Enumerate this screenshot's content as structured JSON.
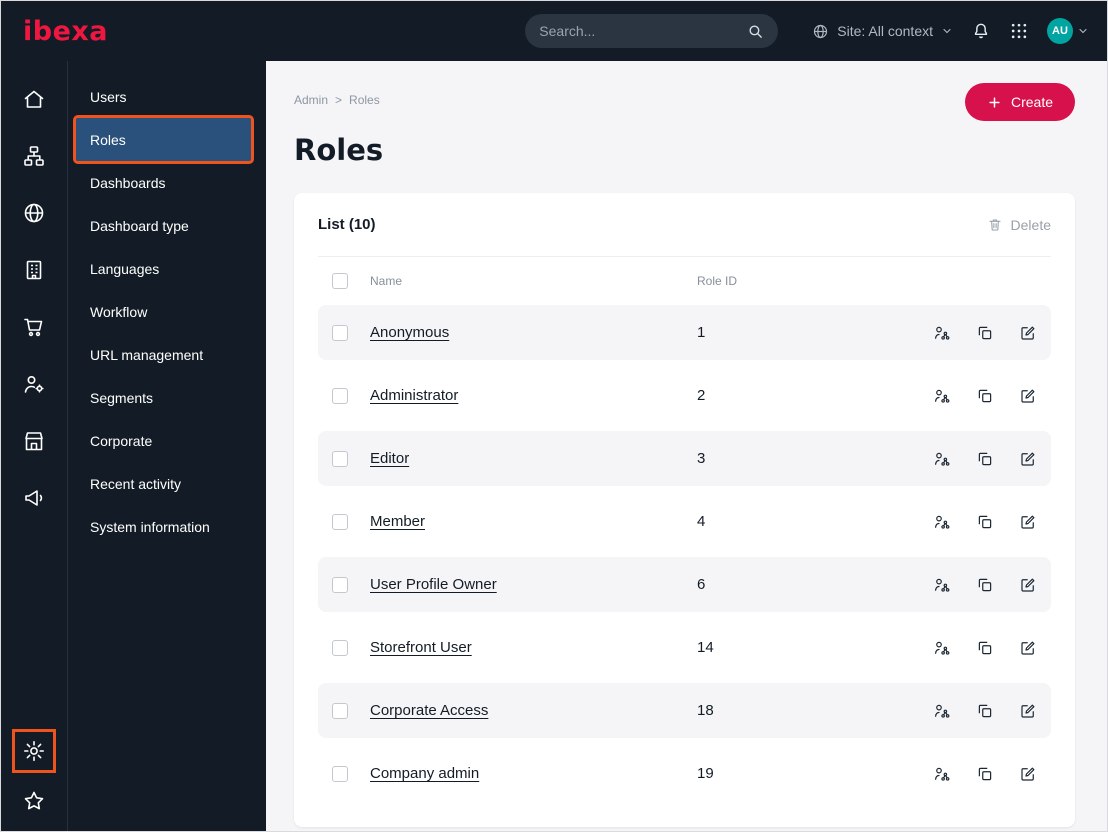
{
  "topbar": {
    "logo": "ibexa",
    "search_placeholder": "Search...",
    "site_context_label": "Site: All context",
    "avatar_initials": "AU"
  },
  "rail": {
    "icons": [
      "home",
      "content-tree",
      "globe",
      "building",
      "cart",
      "user-settings",
      "storefront",
      "megaphone"
    ],
    "bottom_icons": [
      "settings-gear",
      "star"
    ]
  },
  "sidebar": {
    "items": [
      {
        "label": "Users",
        "active": false
      },
      {
        "label": "Roles",
        "active": true
      },
      {
        "label": "Dashboards",
        "active": false
      },
      {
        "label": "Dashboard type",
        "active": false
      },
      {
        "label": "Languages",
        "active": false
      },
      {
        "label": "Workflow",
        "active": false
      },
      {
        "label": "URL management",
        "active": false
      },
      {
        "label": "Segments",
        "active": false
      },
      {
        "label": "Corporate",
        "active": false
      },
      {
        "label": "Recent activity",
        "active": false
      },
      {
        "label": "System information",
        "active": false
      }
    ]
  },
  "breadcrumb": {
    "parent": "Admin",
    "separator": ">",
    "current": "Roles"
  },
  "page": {
    "title": "Roles",
    "create_button": "Create"
  },
  "list": {
    "title": "List (10)",
    "delete_button": "Delete",
    "columns": {
      "name": "Name",
      "role_id": "Role ID"
    },
    "rows": [
      {
        "name": "Anonymous",
        "role_id": "1"
      },
      {
        "name": "Administrator",
        "role_id": "2"
      },
      {
        "name": "Editor",
        "role_id": "3"
      },
      {
        "name": "Member",
        "role_id": "4"
      },
      {
        "name": "User Profile Owner",
        "role_id": "6"
      },
      {
        "name": "Storefront User",
        "role_id": "14"
      },
      {
        "name": "Corporate Access",
        "role_id": "18"
      },
      {
        "name": "Company admin",
        "role_id": "19"
      }
    ]
  },
  "colors": {
    "topbar_bg": "#131c26",
    "accent_red": "#d6114b",
    "selected_blue": "#29517c",
    "annotation_orange": "#f0541e",
    "avatar_teal": "#00a4a0"
  }
}
